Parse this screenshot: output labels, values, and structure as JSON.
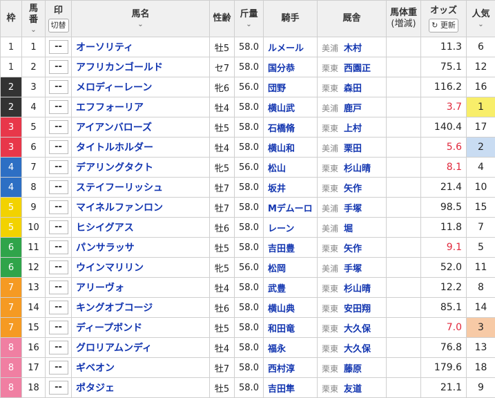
{
  "colors": {
    "waku": {
      "1": "#ffffff",
      "2": "#333333",
      "3": "#e8374a",
      "4": "#2d6fc4",
      "5": "#f2d200",
      "6": "#2fa44a",
      "7": "#f59a23",
      "8": "#f07fa2"
    },
    "waku_text": {
      "1": "#333333",
      "2": "#ffffff",
      "3": "#ffffff",
      "4": "#ffffff",
      "5": "#ffffff",
      "6": "#ffffff",
      "7": "#ffffff",
      "8": "#ffffff"
    },
    "pop": {
      "1": "#f8ee6a",
      "2": "#c9dcf2",
      "3": "#f7caa6"
    }
  },
  "headers": {
    "waku": "枠",
    "umaban_1": "馬",
    "umaban_2": "番",
    "mark": "印",
    "mark_toggle": "切替",
    "horse": "馬名",
    "sexage": "性齢",
    "weight": "斤量",
    "jockey": "騎手",
    "stable": "厩舎",
    "bodyweight_1": "馬体重",
    "bodyweight_2": "(増減)",
    "odds": "オッズ",
    "refresh": "更新",
    "popularity_1": "人気"
  },
  "mark_placeholder": "--",
  "rows": [
    {
      "waku": "1",
      "num": "1",
      "horse": "オーソリティ",
      "sexage": "牡5",
      "weight": "58.0",
      "jockey": "ルメール",
      "region": "美浦",
      "trainer": "木村",
      "bw": "",
      "odds": "11.3",
      "red": false,
      "pop": "6"
    },
    {
      "waku": "1",
      "num": "2",
      "horse": "アフリカンゴールド",
      "sexage": "セ7",
      "weight": "58.0",
      "jockey": "国分恭",
      "region": "栗東",
      "trainer": "西園正",
      "bw": "",
      "odds": "75.1",
      "red": false,
      "pop": "12"
    },
    {
      "waku": "2",
      "num": "3",
      "horse": "メロディーレーン",
      "sexage": "牝6",
      "weight": "56.0",
      "jockey": "団野",
      "region": "栗東",
      "trainer": "森田",
      "bw": "",
      "odds": "116.2",
      "red": false,
      "pop": "16"
    },
    {
      "waku": "2",
      "num": "4",
      "horse": "エフフォーリア",
      "sexage": "牡4",
      "weight": "58.0",
      "jockey": "横山武",
      "region": "美浦",
      "trainer": "鹿戸",
      "bw": "",
      "odds": "3.7",
      "red": true,
      "pop": "1"
    },
    {
      "waku": "3",
      "num": "5",
      "horse": "アイアンバローズ",
      "sexage": "牡5",
      "weight": "58.0",
      "jockey": "石橋脩",
      "region": "栗東",
      "trainer": "上村",
      "bw": "",
      "odds": "140.4",
      "red": false,
      "pop": "17"
    },
    {
      "waku": "3",
      "num": "6",
      "horse": "タイトルホルダー",
      "sexage": "牡4",
      "weight": "58.0",
      "jockey": "横山和",
      "region": "美浦",
      "trainer": "栗田",
      "bw": "",
      "odds": "5.6",
      "red": true,
      "pop": "2"
    },
    {
      "waku": "4",
      "num": "7",
      "horse": "デアリングタクト",
      "sexage": "牝5",
      "weight": "56.0",
      "jockey": "松山",
      "region": "栗東",
      "trainer": "杉山晴",
      "bw": "",
      "odds": "8.1",
      "red": true,
      "pop": "4"
    },
    {
      "waku": "4",
      "num": "8",
      "horse": "ステイフーリッシュ",
      "sexage": "牡7",
      "weight": "58.0",
      "jockey": "坂井",
      "region": "栗東",
      "trainer": "矢作",
      "bw": "",
      "odds": "21.4",
      "red": false,
      "pop": "10"
    },
    {
      "waku": "5",
      "num": "9",
      "horse": "マイネルファンロン",
      "sexage": "牡7",
      "weight": "58.0",
      "jockey": "Mデムーロ",
      "region": "美浦",
      "trainer": "手塚",
      "bw": "",
      "odds": "98.5",
      "red": false,
      "pop": "15"
    },
    {
      "waku": "5",
      "num": "10",
      "horse": "ヒシイグアス",
      "sexage": "牡6",
      "weight": "58.0",
      "jockey": "レーン",
      "region": "美浦",
      "trainer": "堀",
      "bw": "",
      "odds": "11.8",
      "red": false,
      "pop": "7"
    },
    {
      "waku": "6",
      "num": "11",
      "horse": "パンサラッサ",
      "sexage": "牡5",
      "weight": "58.0",
      "jockey": "吉田豊",
      "region": "栗東",
      "trainer": "矢作",
      "bw": "",
      "odds": "9.1",
      "red": true,
      "pop": "5"
    },
    {
      "waku": "6",
      "num": "12",
      "horse": "ウインマリリン",
      "sexage": "牝5",
      "weight": "56.0",
      "jockey": "松岡",
      "region": "美浦",
      "trainer": "手塚",
      "bw": "",
      "odds": "52.0",
      "red": false,
      "pop": "11"
    },
    {
      "waku": "7",
      "num": "13",
      "horse": "アリーヴォ",
      "sexage": "牡4",
      "weight": "58.0",
      "jockey": "武豊",
      "region": "栗東",
      "trainer": "杉山晴",
      "bw": "",
      "odds": "12.2",
      "red": false,
      "pop": "8"
    },
    {
      "waku": "7",
      "num": "14",
      "horse": "キングオブコージ",
      "sexage": "牡6",
      "weight": "58.0",
      "jockey": "横山典",
      "region": "栗東",
      "trainer": "安田翔",
      "bw": "",
      "odds": "85.1",
      "red": false,
      "pop": "14"
    },
    {
      "waku": "7",
      "num": "15",
      "horse": "ディープボンド",
      "sexage": "牡5",
      "weight": "58.0",
      "jockey": "和田竜",
      "region": "栗東",
      "trainer": "大久保",
      "bw": "",
      "odds": "7.0",
      "red": true,
      "pop": "3"
    },
    {
      "waku": "8",
      "num": "16",
      "horse": "グロリアムンディ",
      "sexage": "牡4",
      "weight": "58.0",
      "jockey": "福永",
      "region": "栗東",
      "trainer": "大久保",
      "bw": "",
      "odds": "76.8",
      "red": false,
      "pop": "13"
    },
    {
      "waku": "8",
      "num": "17",
      "horse": "ギベオン",
      "sexage": "牡7",
      "weight": "58.0",
      "jockey": "西村淳",
      "region": "栗東",
      "trainer": "藤原",
      "bw": "",
      "odds": "179.6",
      "red": false,
      "pop": "18"
    },
    {
      "waku": "8",
      "num": "18",
      "horse": "ポタジェ",
      "sexage": "牡5",
      "weight": "58.0",
      "jockey": "吉田隼",
      "region": "栗東",
      "trainer": "友道",
      "bw": "",
      "odds": "21.1",
      "red": false,
      "pop": "9"
    }
  ]
}
